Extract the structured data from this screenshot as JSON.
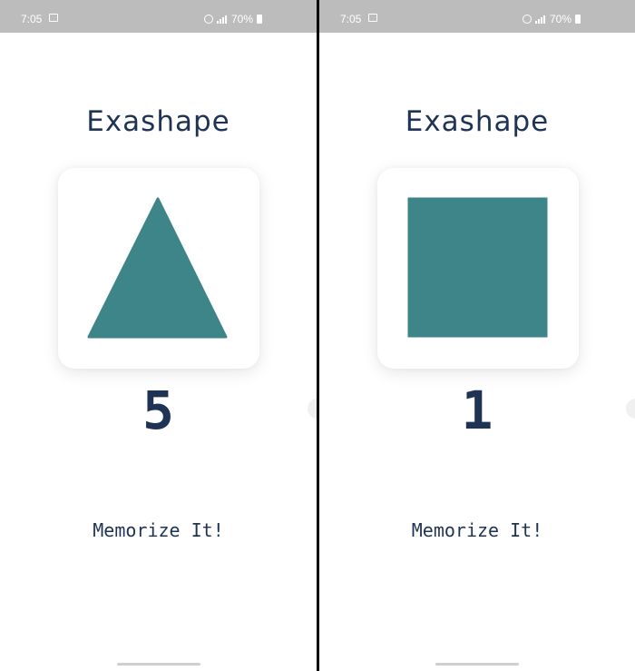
{
  "screens": [
    {
      "status_bar": {
        "time": "7:05",
        "battery": "70%"
      },
      "title": "Exashape",
      "shape": {
        "kind": "triangle",
        "color": "#3e8589"
      },
      "number": "5",
      "memorize_label": "Memorize It!"
    },
    {
      "status_bar": {
        "time": "7:05",
        "battery": "70%"
      },
      "title": "Exashape",
      "shape": {
        "kind": "square",
        "color": "#3e8589"
      },
      "number": "1",
      "memorize_label": "Memorize It!"
    }
  ],
  "colors": {
    "text": "#1f3355",
    "shape": "#3e8589",
    "status_bar": "#bcbcbc"
  },
  "icons": [
    "gallery-icon",
    "alarm-icon",
    "signal-icon",
    "battery-icon"
  ]
}
